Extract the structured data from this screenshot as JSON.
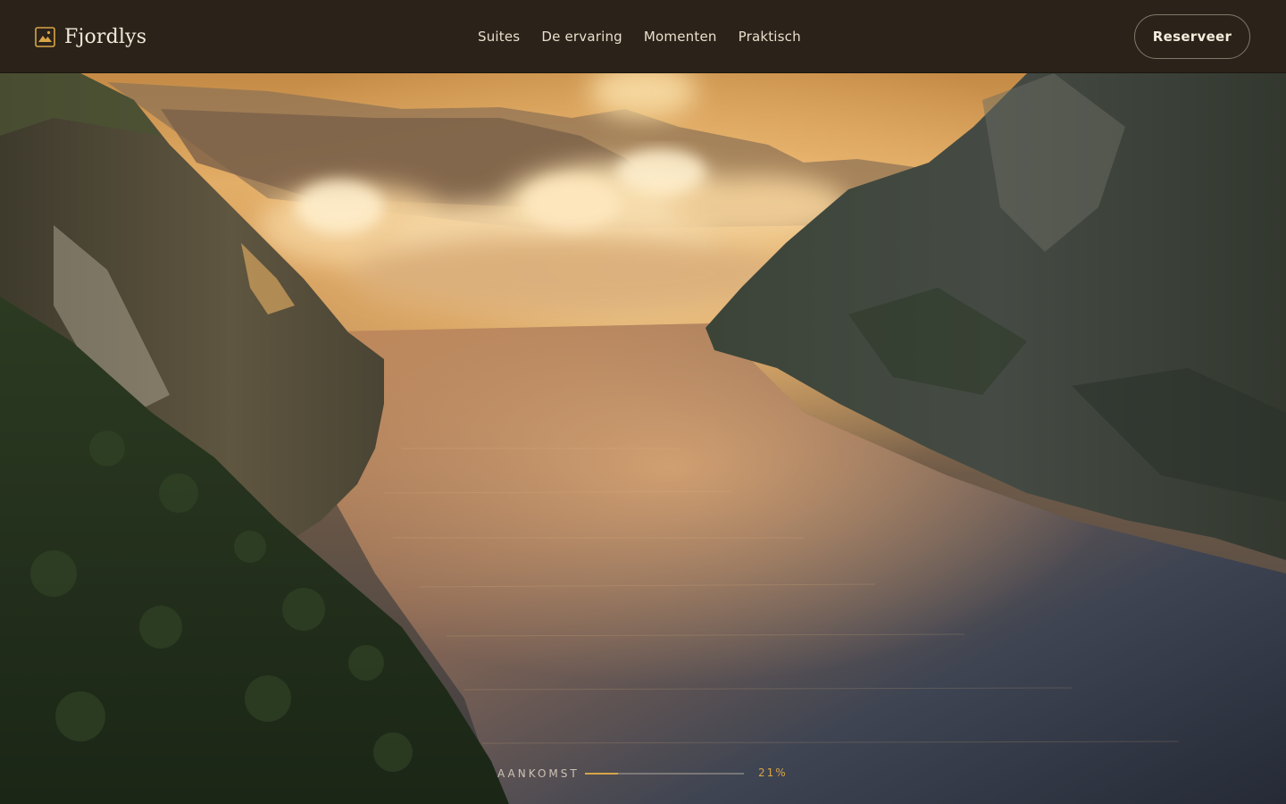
{
  "header": {
    "brand_name": "Fjordlys",
    "logo_icon": "mountain-sun-icon",
    "nav": [
      {
        "label": "Suites"
      },
      {
        "label": "De ervaring"
      },
      {
        "label": "Momenten"
      },
      {
        "label": "Praktisch"
      }
    ],
    "cta_label": "Reserveer"
  },
  "hero": {
    "image_subject": "fjord-at-sunset"
  },
  "progress": {
    "label": "AANKOMST",
    "value_text": "21%",
    "fraction": 0.21
  },
  "colors": {
    "accent": "#d9a548",
    "header_bg": "#2b2319",
    "text_light": "#f2ead9"
  }
}
